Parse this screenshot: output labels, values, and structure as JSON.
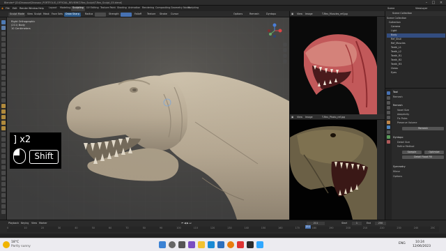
{
  "window": {
    "title": "Blender* [D:\\Dinosaur\\Dinosaur_PORTFOLIO_OFFICIAL_REVIEW\\T-Rex_Sculpt\\T-Rex_Sculpt_03.blend]"
  },
  "menubar": {
    "items": [
      "File",
      "Edit",
      "Render",
      "Window",
      "Help"
    ],
    "workspaces": [
      "Layout",
      "Modeling",
      "Sculpting",
      "UV Editing",
      "Texture Paint",
      "Shading",
      "Animation",
      "Rendering",
      "Compositing",
      "Geometry Nodes",
      "Scripting"
    ],
    "active_workspace": "Sculpting",
    "scene": "Scene",
    "view_layer": "ViewLayer"
  },
  "header": {
    "mode": "Sculpt Mode",
    "menus": [
      "View",
      "Sculpt",
      "Mask",
      "Face Sets"
    ],
    "brush": "Draw Sharp",
    "radius_label": "Radius",
    "strength_label": "Strength",
    "falloff_label": "Falloff",
    "texture_label": "Texture",
    "stroke_label": "Stroke",
    "cursor_label": "Cursor",
    "options_label": "Options",
    "remesh_label": "Remesh",
    "dyntopo_label": "Dyntopo"
  },
  "viewport": {
    "view_name": "Right Orthographic",
    "object_line": "(211) Body",
    "scale_line": "10 Centimeters"
  },
  "keyhint": {
    "key_text": "] x2",
    "modifier": "Shift"
  },
  "image_editor_top": {
    "menus": [
      "View",
      "Image"
    ],
    "image_name": "T-Rex_Muscles_ref.jpg"
  },
  "image_editor_bottom": {
    "menus": [
      "View",
      "Image"
    ],
    "image_name": "T-Rex_Photo_ref.jpg"
  },
  "outliner": {
    "header": "Scene Collection",
    "rows": [
      "Scene Collection",
      "Collection",
      "Camera",
      "Light",
      "Body",
      "Ref_Skull",
      "Ref_Muscles",
      "Teeth_L1",
      "Teeth_L2",
      "Teeth_R1",
      "Teeth_R2",
      "Teeth_R3",
      "Claws",
      "Eyes"
    ]
  },
  "properties": {
    "tool_header": "Tool",
    "brush_name": "Remesh",
    "rows": [
      "Remesh",
      "Voxel Size",
      "Adaptivity",
      "Fix Poles",
      "Preserve Volume",
      "Dyntopo",
      "Detail Size",
      "Refine Method",
      "Symmetry",
      "Mirror",
      "Options"
    ],
    "buttons": [
      "Remesh",
      "Sample",
      "Optimize",
      "Detail Flood Fill"
    ]
  },
  "timeline": {
    "menus": [
      "Playback",
      "Keying",
      "View",
      "Marker"
    ],
    "ticks": [
      "0",
      "10",
      "20",
      "30",
      "40",
      "50",
      "60",
      "70",
      "80",
      "90",
      "100",
      "110",
      "120",
      "130",
      "140",
      "150",
      "160",
      "170",
      "180",
      "190",
      "200",
      "210",
      "220",
      "230",
      "240",
      "250"
    ],
    "current_frame": "211",
    "start_label": "Start",
    "start": "1",
    "end_label": "End",
    "end": "250"
  },
  "taskbar": {
    "weather_temp": "18°C",
    "weather_desc": "Partly sunny",
    "time": "10:24",
    "date": "12/06/2023",
    "lang": "ENG"
  },
  "colors": {
    "accent_blue": "#4772b3",
    "viewport_bg": "#3d3d3d",
    "sculpt_clay": "#b8ab95"
  }
}
